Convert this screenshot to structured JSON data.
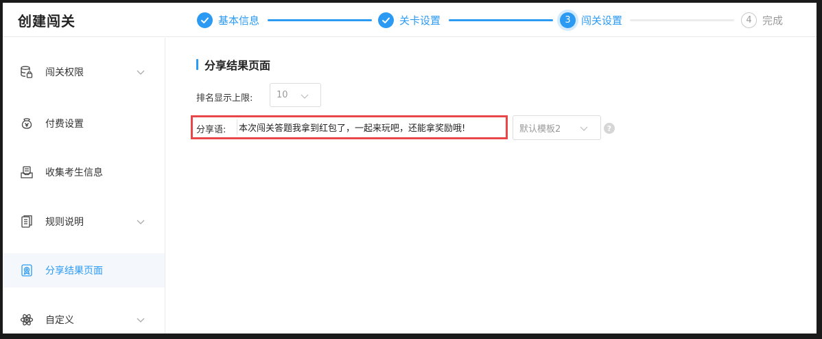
{
  "header": {
    "title": "创建闯关",
    "steps": [
      {
        "number": "1",
        "label": "基本信息",
        "state": "done"
      },
      {
        "number": "2",
        "label": "关卡设置",
        "state": "done"
      },
      {
        "number": "3",
        "label": "闯关设置",
        "state": "active"
      },
      {
        "number": "4",
        "label": "完成",
        "state": "pending"
      }
    ]
  },
  "sidebar": {
    "items": [
      {
        "label": "闯关权限",
        "icon": "database-lock-icon",
        "expandable": true
      },
      {
        "label": "付费设置",
        "icon": "money-bag-icon",
        "expandable": false
      },
      {
        "label": "收集考生信息",
        "icon": "inbox-form-icon",
        "expandable": false
      },
      {
        "label": "规则说明",
        "icon": "document-list-icon",
        "expandable": true
      },
      {
        "label": "分享结果页面",
        "icon": "share-badge-icon",
        "expandable": false,
        "active": true
      },
      {
        "label": "自定义",
        "icon": "atom-icon",
        "expandable": true
      }
    ]
  },
  "main": {
    "section_title": "分享结果页面",
    "rank_limit": {
      "label": "排名显示上限:",
      "value": "10"
    },
    "share_text": {
      "label": "分享语:",
      "value": "本次闯关答题我拿到红包了，一起来玩吧，还能拿奖励哦!"
    },
    "template_select": {
      "value": "默认模板2"
    },
    "help_icon": "question-circle-icon"
  },
  "colors": {
    "accent": "#2b9af3",
    "highlight_border": "#e8474a",
    "active_bg": "#f4f8fc"
  }
}
